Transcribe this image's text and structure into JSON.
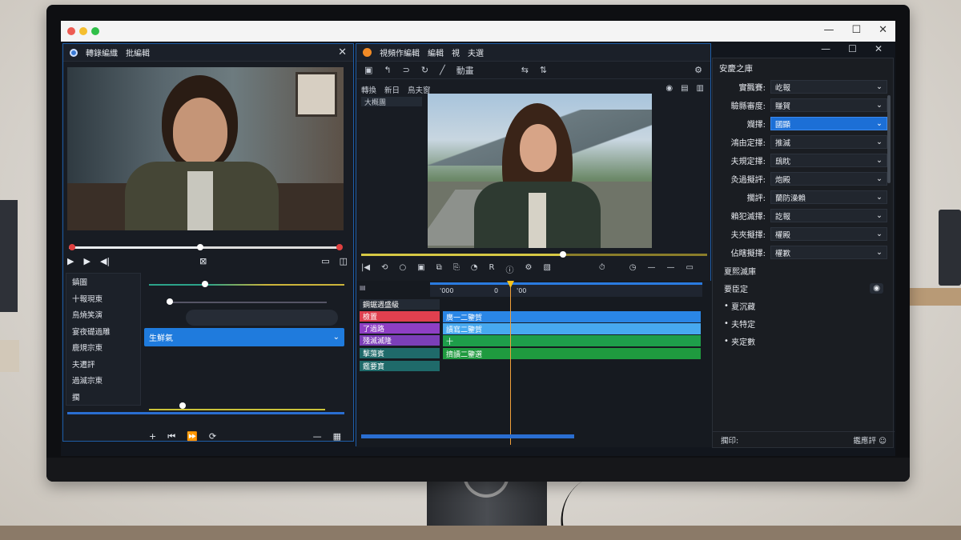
{
  "left_window": {
    "title": "轉錄編織",
    "subtitle": "批編輯",
    "side_menu": [
      "鎮圖",
      "十報現東",
      "鳥燒笑演",
      "宴夜礎過雕",
      "鹿規宗東",
      "夫遷評",
      "過滅宗東",
      "擱"
    ],
    "blue_row_label": "生鮮氣"
  },
  "mid_window": {
    "title": "視頻作編輯",
    "menu": [
      "編輯",
      "視",
      "夫選"
    ],
    "tool_label": "動畫",
    "tabs": [
      "轉換",
      "新日",
      "鳥夫窗"
    ],
    "bin_label": "大概團",
    "ruler_labels": [
      "'000",
      "0",
      "'00"
    ],
    "tracks": [
      {
        "label": "鋼鋸週盛級",
        "color": "#232a34"
      },
      {
        "label": "檢置",
        "color": "#e0404f"
      },
      {
        "label": "了過路",
        "color": "#8e3fc4"
      },
      {
        "label": "殘滅滅隆",
        "color": "#7b3fb8"
      },
      {
        "label": "擊蕩賓",
        "color": "#1f6a6a"
      },
      {
        "label": "鑑要寶",
        "color": "#1f6a6a"
      }
    ],
    "clips": [
      {
        "label": "廣一二鑒賀",
        "color": "#2a86e6"
      },
      {
        "label": "讀寫二鑒賀",
        "color": "#47a9f0"
      },
      {
        "label": "十",
        "color": "#1e9e4a"
      },
      {
        "label": "擠讀二鑒選",
        "color": "#1f9a3f"
      }
    ]
  },
  "right_panel": {
    "title": "安慶之庫",
    "props": [
      {
        "label": "實飄賽:",
        "value": "屹報"
      },
      {
        "label": "驗縣審度:",
        "value": "賺賀"
      },
      {
        "label": "斕擇:",
        "value": "國顯",
        "active": true
      },
      {
        "label": "鴻由定擇:",
        "value": "推滅"
      },
      {
        "label": "夫規定擇:",
        "value": "鴟眈"
      },
      {
        "label": "灸過擬評:",
        "value": "炮殿"
      },
      {
        "label": "擱評:",
        "value": "蘭防澡賴"
      },
      {
        "label": "賴犯滅擇:",
        "value": "訖報"
      },
      {
        "label": "夫夾擬擇:",
        "value": "權殿"
      },
      {
        "label": "佔瞎擬擇:",
        "value": "權歉"
      }
    ],
    "subs": [
      "夏熙滅庫",
      "要臣定",
      "夏沉藏",
      "夫特定",
      "夹定數"
    ],
    "footer_left": "擱印:",
    "footer_right": "鑑應評"
  }
}
